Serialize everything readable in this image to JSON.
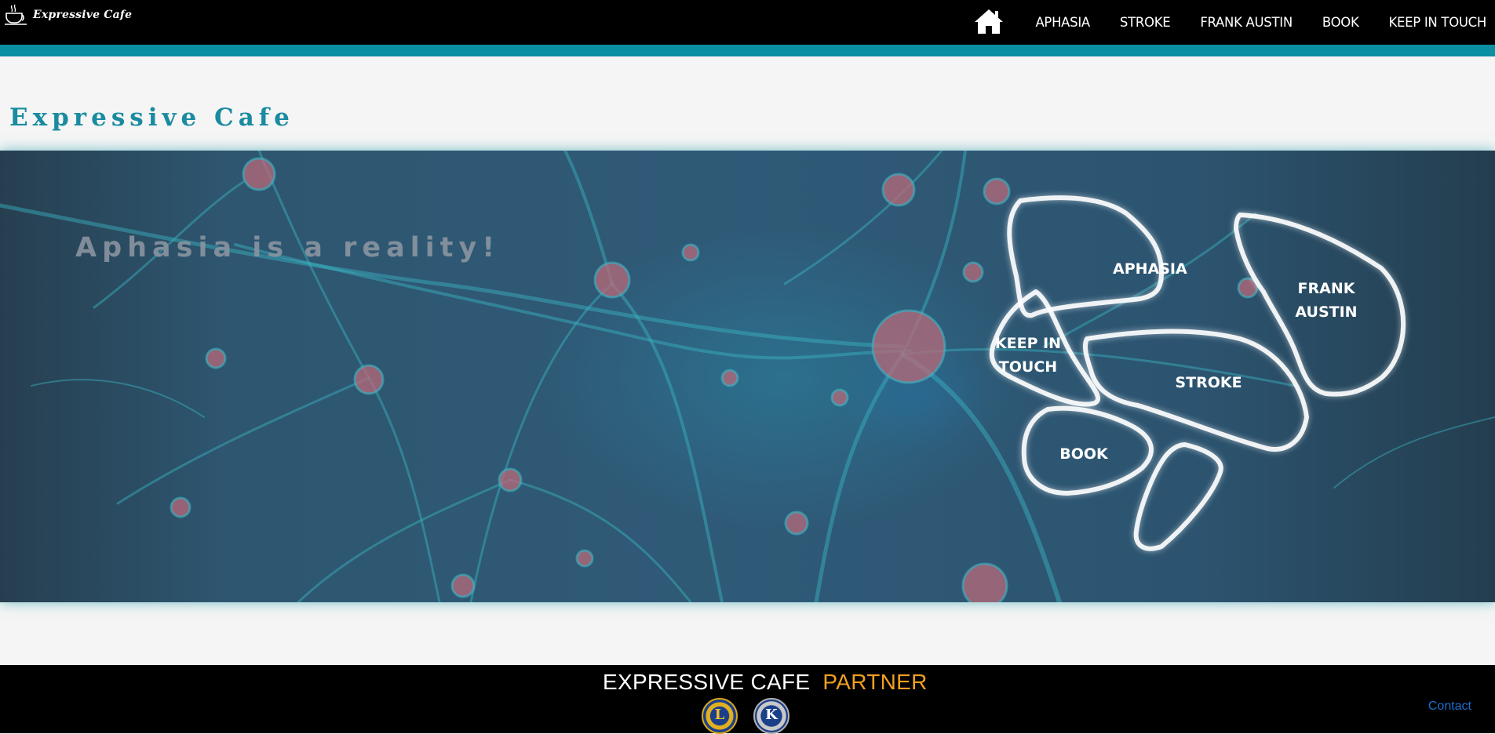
{
  "header": {
    "logo_text": "Expressive Cafe",
    "nav": [
      {
        "label": "APHASIA"
      },
      {
        "label": "STROKE"
      },
      {
        "label": "FRANK AUSTIN"
      },
      {
        "label": "BOOK"
      },
      {
        "label": "KEEP IN TOUCH"
      }
    ]
  },
  "main": {
    "site_title": "Expressive Cafe",
    "hero": {
      "tagline": "Aphasia is a reality!",
      "brain_map": {
        "aphasia": "APHASIA",
        "frank_austin_line1": "FRANK",
        "frank_austin_line2": "AUSTIN",
        "keep_in_touch_line1": "KEEP IN",
        "keep_in_touch_line2": "TOUCH",
        "stroke": "STROKE",
        "book": "BOOK"
      }
    }
  },
  "footer": {
    "title_part1": "EXPRESSIVE CAFE",
    "title_part2": "PARTNER",
    "partner_1_letter": "L",
    "partner_2_letter": "K",
    "contact_label": "Contact",
    "colors": {
      "accent": "#f0a020",
      "link": "#1e6fd0"
    }
  },
  "colors": {
    "teal_bar": "#0a8fa3",
    "title": "#1a8ba0",
    "background": "#f5f5f5"
  }
}
